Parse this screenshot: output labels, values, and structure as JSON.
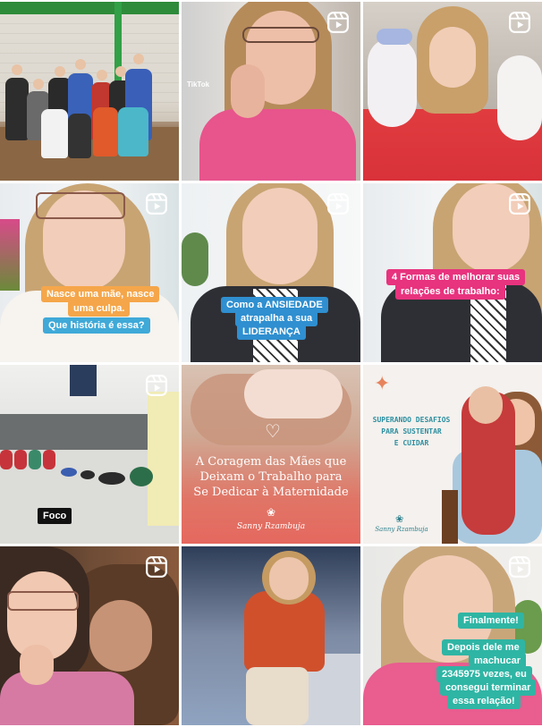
{
  "grid": {
    "tiles": [
      {
        "id": 1,
        "type": "photo",
        "description_tag": "team-photo"
      },
      {
        "id": 2,
        "type": "reel",
        "overlay_text": "TikTok"
      },
      {
        "id": 3,
        "type": "reel"
      },
      {
        "id": 4,
        "type": "reel",
        "captions": [
          "Nasce uma mãe, nasce",
          "uma culpa.",
          "Que história é essa?"
        ]
      },
      {
        "id": 5,
        "type": "reel",
        "captions": [
          "Como a ANSIEDADE",
          "atrapalha a sua",
          "LIDERANÇA"
        ]
      },
      {
        "id": 6,
        "type": "reel",
        "captions": [
          "4 Formas de melhorar suas",
          "relações de trabalho:"
        ]
      },
      {
        "id": 7,
        "type": "reel",
        "captions": [
          "Foco"
        ]
      },
      {
        "id": 8,
        "type": "post",
        "title": "A Coragem das Mães que\nDeixam o Trabalho para\nSe Dedicar à Maternidade",
        "brand": "Sanny Rzambuja"
      },
      {
        "id": 9,
        "type": "post",
        "title": "SUPERANDO DESAFIOS\nPARA SUSTENTAR\nE CUIDAR",
        "brand": "Sanny Rzambuja"
      },
      {
        "id": 10,
        "type": "reel"
      },
      {
        "id": 11,
        "type": "photo"
      },
      {
        "id": 12,
        "type": "reel",
        "captions": [
          "Finalmente!",
          "Depois dele me",
          "machucar",
          "2345975 vezes, eu",
          "consegui terminar",
          "essa relação!"
        ]
      }
    ]
  },
  "icons": {
    "reel": "reel-icon",
    "heart": "heart-icon",
    "lotus": "lotus-icon",
    "star": "sparkle-icon"
  },
  "colors": {
    "caption_orange": "#f5a64a",
    "caption_blue": "#3fa9d8",
    "caption_pink": "#e8337e",
    "caption_green": "#2fb5a4",
    "coral_post": "#e5685f"
  }
}
